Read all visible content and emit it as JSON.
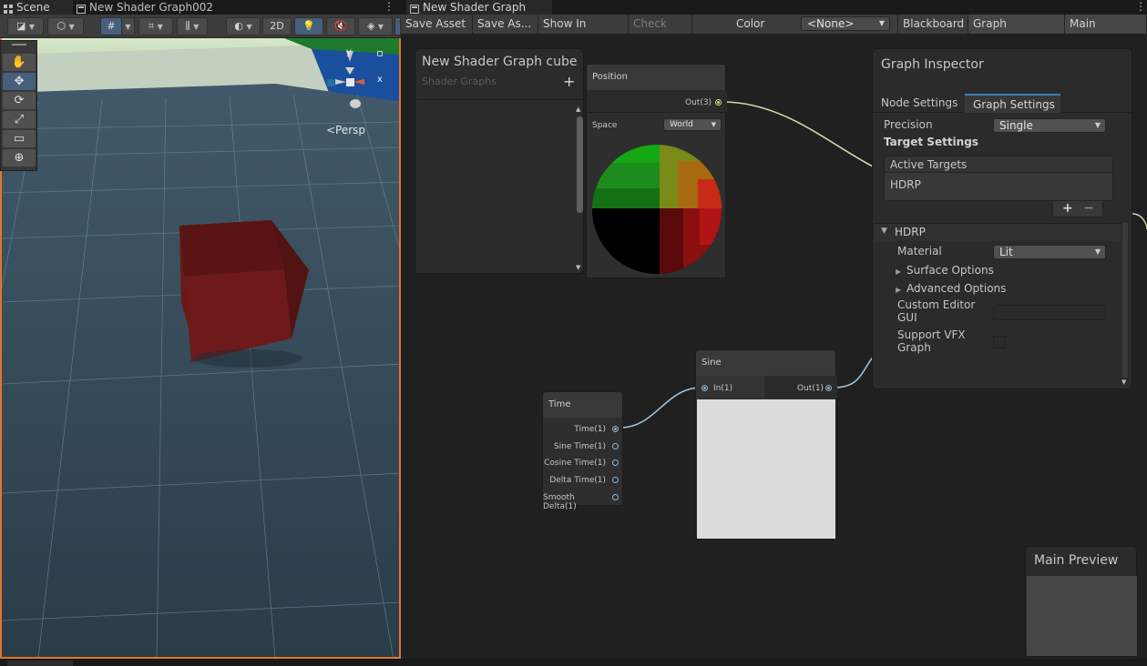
{
  "scene_tabs": {
    "scene": "Scene",
    "graph002": "New Shader Graph002"
  },
  "scene_toolbar": {
    "twod": "2D"
  },
  "scene_view": {
    "persp_label": "<Persp",
    "gizmo_y": "y",
    "gizmo_x": "x",
    "cube_color": "#6e1a1a",
    "selection_border_color": "#e0762c"
  },
  "graph_tab": {
    "title": "New Shader Graph cube"
  },
  "graph_toolbar": {
    "save_asset": "Save Asset",
    "save_as": "Save As...",
    "show_in_project": "Show In Project",
    "check_out": "Check Out",
    "color_mode_label": "Color Mode",
    "color_mode_value": "<None>",
    "blackboard": "Blackboard",
    "graph_inspector": "Graph Inspector",
    "main_preview": "Main Preview"
  },
  "blackboard": {
    "title": "New Shader Graph cube",
    "subtitle": "Shader Graphs",
    "add": "+"
  },
  "nodes": {
    "position": {
      "title": "Position",
      "out": "Out(3)",
      "space_label": "Space",
      "space_value": "World"
    },
    "time": {
      "title": "Time",
      "ports": [
        "Time(1)",
        "Sine Time(1)",
        "Cosine Time(1)",
        "Delta Time(1)",
        "Smooth Delta(1)"
      ]
    },
    "sine": {
      "title": "Sine",
      "in": "In(1)",
      "out": "Out(1)"
    }
  },
  "inspector": {
    "title": "Graph Inspector",
    "tabs": [
      "Node Settings",
      "Graph Settings"
    ],
    "active_tab": "Graph Settings",
    "precision_label": "Precision",
    "precision_value": "Single",
    "target_settings": "Target Settings",
    "active_targets_header": "Active Targets",
    "active_targets": [
      "HDRP"
    ],
    "add": "+",
    "remove": "−",
    "hdrp_section": "HDRP",
    "material_label": "Material",
    "material_value": "Lit",
    "surface_options": "Surface Options",
    "advanced_options": "Advanced Options",
    "custom_editor_gui": "Custom Editor GUI",
    "support_vfx_graph": "Support VFX Graph"
  },
  "main_preview": {
    "title": "Main Preview"
  },
  "colors": {
    "accent_blue": "#46607c",
    "wire_yellow": "#d8d8a8",
    "wire_blue": "#9cc4dc"
  }
}
